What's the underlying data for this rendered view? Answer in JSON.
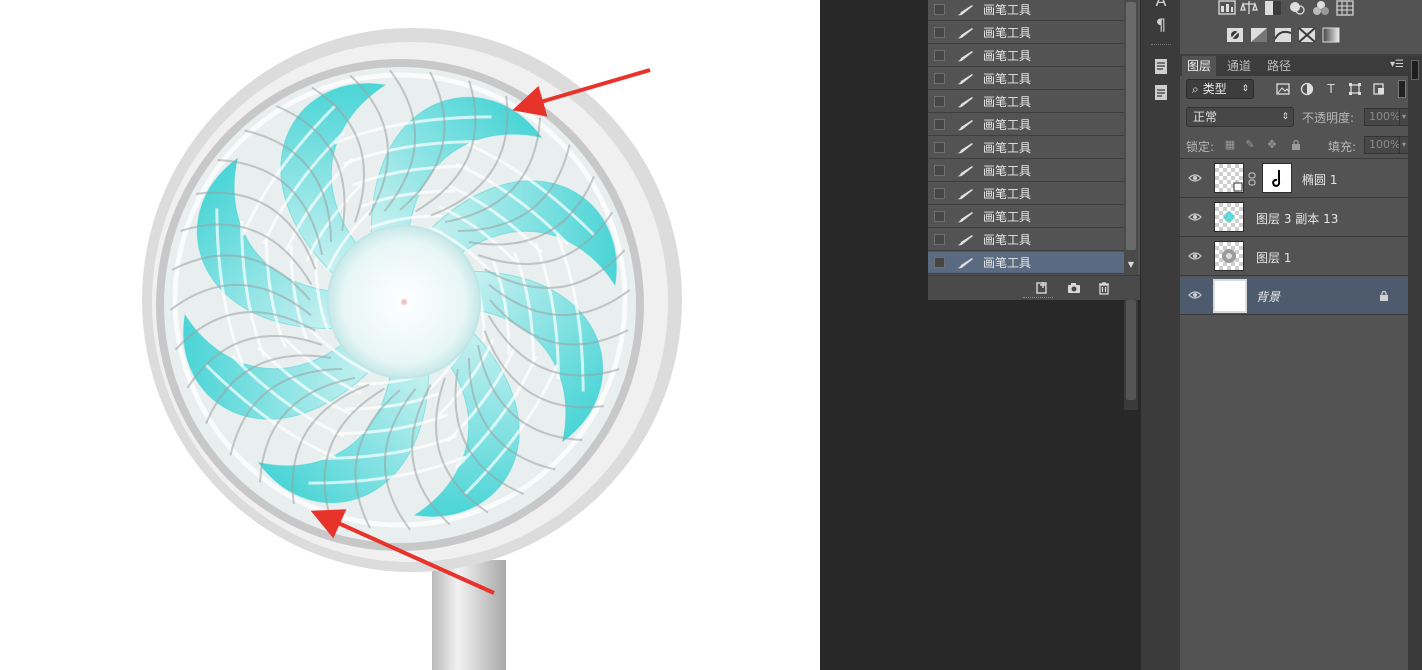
{
  "canvas": {
    "annotation_color": "#e8332a",
    "fan_blade_color": "#3fd6d8"
  },
  "history": {
    "items": [
      {
        "label": "画笔工具"
      },
      {
        "label": "画笔工具"
      },
      {
        "label": "画笔工具"
      },
      {
        "label": "画笔工具"
      },
      {
        "label": "画笔工具"
      },
      {
        "label": "画笔工具"
      },
      {
        "label": "画笔工具"
      },
      {
        "label": "画笔工具"
      },
      {
        "label": "画笔工具"
      },
      {
        "label": "画笔工具"
      },
      {
        "label": "画笔工具"
      },
      {
        "label": "画笔工具",
        "selected": true
      }
    ],
    "footer_icons": [
      "new-document-from-state-icon",
      "camera-snapshot-icon",
      "trash-icon"
    ]
  },
  "icon_strip": {
    "icons": [
      "character-icon",
      "paragraph-icon",
      "notes-panel-icon",
      "properties-panel-icon"
    ],
    "paragraph_glyph": "¶"
  },
  "adjustments": {
    "icons": [
      "levels-icon",
      "balance-icon",
      "curves-icon",
      "brightness-icon",
      "color-balance-icon",
      "channel-mixer-icon",
      "invert-icon",
      "posterize-icon",
      "threshold-icon",
      "selective-color-icon",
      "gradient-map-icon"
    ]
  },
  "layers_panel": {
    "tabs": [
      {
        "label": "图层",
        "active": true
      },
      {
        "label": "通道",
        "active": false
      },
      {
        "label": "路径",
        "active": false
      }
    ],
    "filter_label": "类型",
    "filter_icon_glyphs": {
      "type": "T"
    },
    "blend_mode": "正常",
    "opacity_label": "不透明度:",
    "opacity_value": "100%",
    "lock_label": "锁定:",
    "fill_label": "填充:",
    "fill_value": "100%",
    "layers": [
      {
        "name": "椭圆 1",
        "visible": true,
        "selected": false,
        "has_mask": true
      },
      {
        "name": "图层 3 副本 13",
        "visible": true,
        "selected": false
      },
      {
        "name": "图层 1",
        "visible": true,
        "selected": false
      },
      {
        "name": "背景",
        "visible": true,
        "selected": true,
        "locked": true
      }
    ]
  }
}
